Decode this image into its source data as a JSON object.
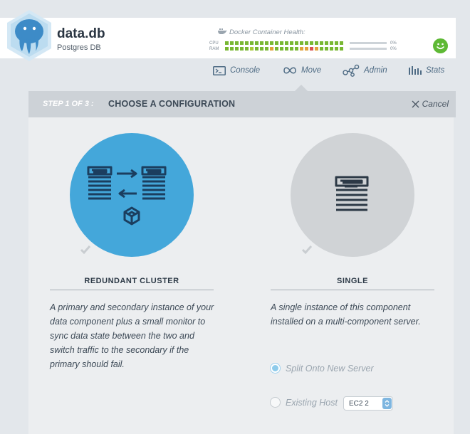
{
  "app": {
    "name": "data.db",
    "subtitle": "Postgres DB"
  },
  "health": {
    "title": "Docker Container Health:",
    "cpu_label": "CPU",
    "ram_label": "RAM",
    "cpu_pct": "0%",
    "ram_pct": "0%",
    "cpu_cells": [
      "#78b732",
      "#78b732",
      "#78b732",
      "#78b732",
      "#78b732",
      "#78b732",
      "#78b732",
      "#78b732",
      "#78b732",
      "#78b732",
      "#78b732",
      "#78b732",
      "#78b732",
      "#78b732",
      "#78b732",
      "#78b732",
      "#78b732",
      "#78b732",
      "#78b732",
      "#78b732",
      "#78b732",
      "#78b732",
      "#78b732",
      "#78b732"
    ],
    "ram_cells": [
      "#78b732",
      "#78b732",
      "#78b732",
      "#78b732",
      "#78b732",
      "#a9c93a",
      "#78b732",
      "#78b732",
      "#78b732",
      "#e0a13a",
      "#78b732",
      "#78b732",
      "#78b732",
      "#78b732",
      "#78b732",
      "#e0a13a",
      "#e0a13a",
      "#d9534f",
      "#e0a13a",
      "#78b732",
      "#78b732",
      "#78b732",
      "#78b732",
      "#78b732"
    ],
    "status_color": "#5eb935"
  },
  "nav": {
    "console": "Console",
    "move": "Move",
    "admin": "Admin",
    "stats": "Stats"
  },
  "step": {
    "number": "STEP 1 OF 3 :",
    "title": "CHOOSE A CONFIGURATION",
    "cancel": "Cancel"
  },
  "options": {
    "cluster": {
      "title": "REDUNDANT CLUSTER",
      "description": "A primary and secondary instance of your data component plus a small monitor to sync data state between the two and switch traffic to the secondary if the primary should fail.",
      "color": "#44a7da"
    },
    "single": {
      "title": "SINGLE",
      "description": "A single instance of this component installed on a multi-component server.",
      "color": "#d0d3d6",
      "radio_new_server": "Split Onto New Server",
      "radio_existing_host": "Existing Host",
      "host_select_value": "EC2 2"
    }
  }
}
